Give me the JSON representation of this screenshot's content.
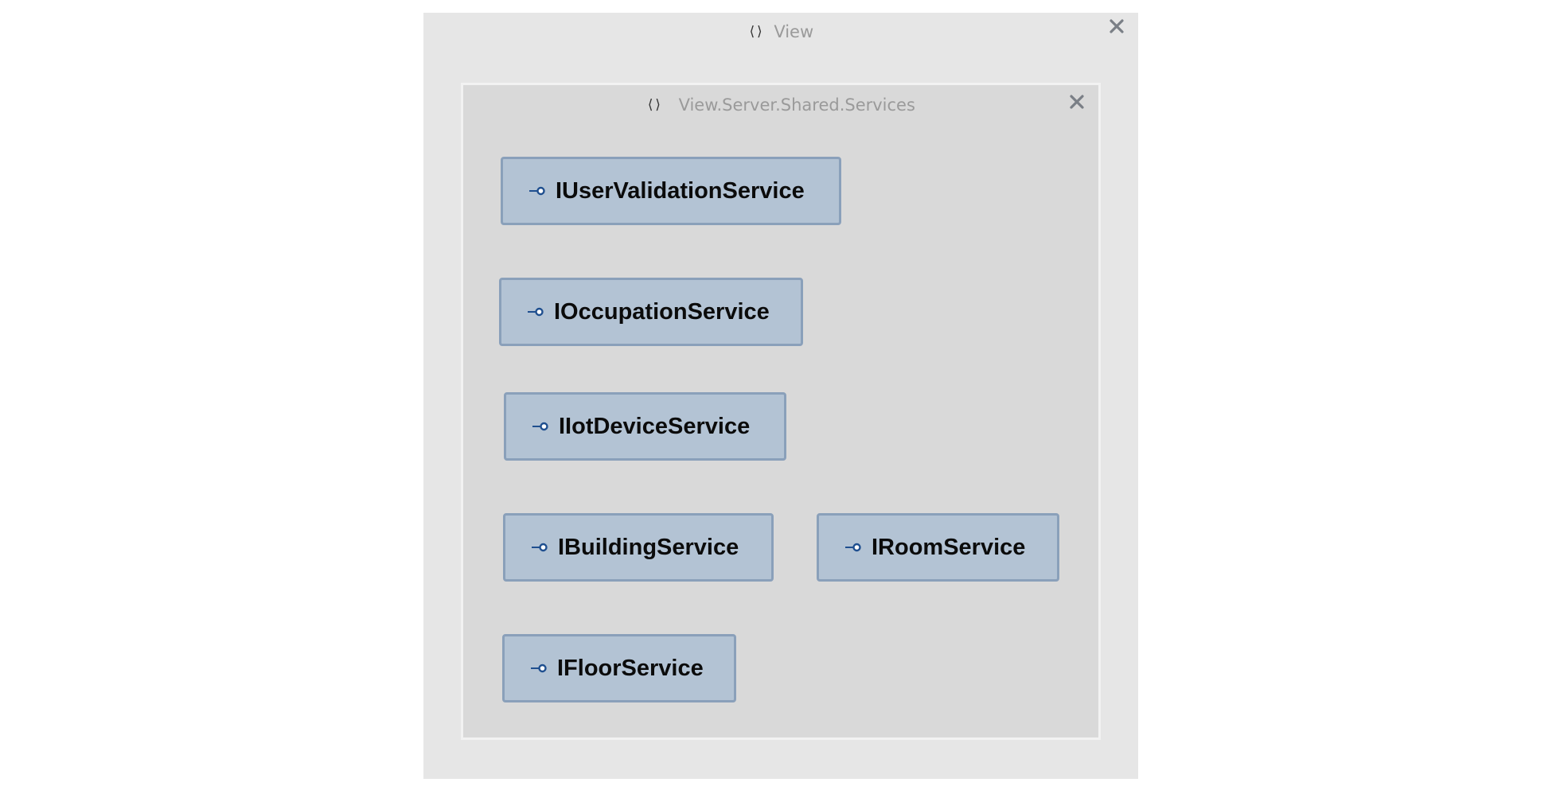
{
  "outer_namespace": {
    "icon": "namespace-braces-icon",
    "glyph": "⟨⟩",
    "title": "View"
  },
  "inner_namespace": {
    "icon": "namespace-braces-icon",
    "glyph": "⟨⟩",
    "title": "View.Server.Shared.Services"
  },
  "interfaces": [
    {
      "name": "IUserValidationService",
      "icon": "interface-lollipop-icon"
    },
    {
      "name": "IOccupationService",
      "icon": "interface-lollipop-icon"
    },
    {
      "name": "IIotDeviceService",
      "icon": "interface-lollipop-icon"
    },
    {
      "name": "IBuildingService",
      "icon": "interface-lollipop-icon"
    },
    {
      "name": "IRoomService",
      "icon": "interface-lollipop-icon"
    },
    {
      "name": "IFloorService",
      "icon": "interface-lollipop-icon"
    }
  ],
  "colors": {
    "outer_bg": "#e6e6e6",
    "inner_bg": "#d9d9d9",
    "node_fill": "#b3c3d4",
    "node_border": "#8aa0ba",
    "icon_blue": "#1f4f8f",
    "title_gray": "#9a9a9a"
  }
}
